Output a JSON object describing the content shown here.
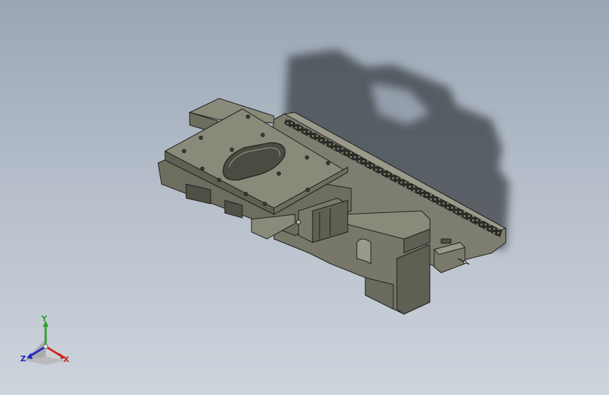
{
  "window": {
    "title": ""
  },
  "colors": {
    "background_top": "#9aa6b5",
    "background_bottom": "#ced4dc",
    "part_fill": "#7b7b6d",
    "part_top": "#8a8a7b",
    "part_side": "#55554a",
    "edge": "#1e1e1a",
    "axis_x": "#d02424",
    "axis_y": "#2fa02f",
    "axis_z": "#2424c8"
  },
  "model": {
    "name": "3d-model-linear-stage",
    "view": "isometric",
    "shadow": true
  },
  "triad": {
    "x_label": "X",
    "y_label": "Y",
    "z_label": "Z",
    "icons": [
      "x-axis-arrow-icon",
      "y-axis-arrow-icon",
      "z-axis-arrow-icon"
    ]
  }
}
